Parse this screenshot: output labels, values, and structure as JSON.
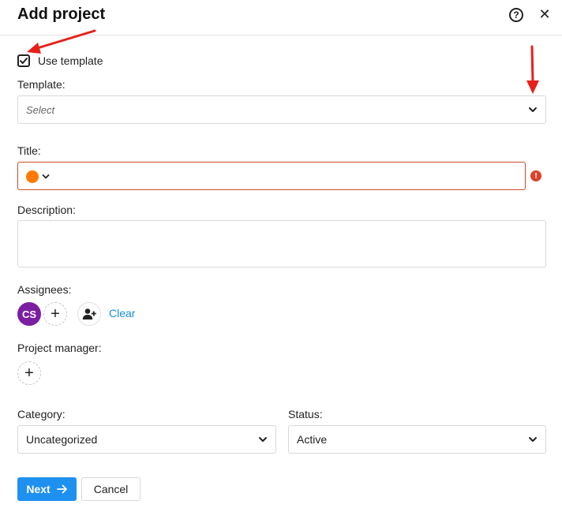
{
  "dialog": {
    "title": "Add project",
    "help_glyph": "?",
    "close_glyph": "✕"
  },
  "template": {
    "use_template_label": "Use template",
    "use_template_checked": true,
    "label": "Template:",
    "placeholder": "Select"
  },
  "title_field": {
    "label": "Title:",
    "value": "",
    "color": "#ff7a00",
    "error_glyph": "!"
  },
  "description": {
    "label": "Description:",
    "value": ""
  },
  "assignees": {
    "label": "Assignees:",
    "avatar_initials": "CS",
    "avatar_color": "#7b1fa2",
    "add_glyph": "+",
    "clear_label": "Clear"
  },
  "project_manager": {
    "label": "Project manager:",
    "add_glyph": "+"
  },
  "category": {
    "label": "Category:",
    "selected": "Uncategorized"
  },
  "status": {
    "label": "Status:",
    "selected": "Active"
  },
  "footer": {
    "next_label": "Next",
    "cancel_label": "Cancel"
  },
  "colors": {
    "accent": "#1e90f0",
    "error": "#d8432a",
    "annotation": "#e8201a"
  }
}
